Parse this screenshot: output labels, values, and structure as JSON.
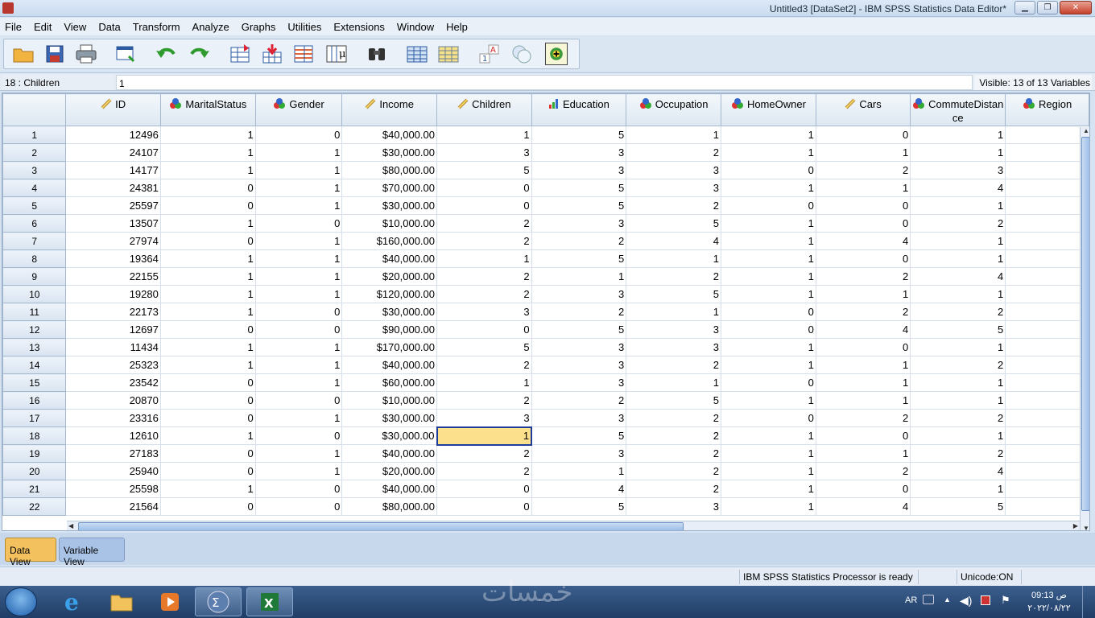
{
  "window": {
    "title": "Untitled3 [DataSet2] - IBM SPSS Statistics Data Editor*"
  },
  "menu": [
    "File",
    "Edit",
    "View",
    "Data",
    "Transform",
    "Analyze",
    "Graphs",
    "Utilities",
    "Extensions",
    "Window",
    "Help"
  ],
  "toolbar_icons": [
    "open-folder-icon",
    "save-icon",
    "print-icon",
    "dialog-recall-icon",
    "undo-icon",
    "redo-icon",
    "goto-case-icon",
    "goto-variable-icon",
    "variables-icon",
    "mu-icon",
    "find-icon",
    "insert-cases-icon",
    "insert-variable-icon",
    "split-file-icon",
    "weight-cases-icon",
    "select-cases-icon",
    "value-labels-icon"
  ],
  "cell_editor": {
    "reference": "18 : Children",
    "value": "1",
    "visible": "Visible: 13 of 13 Variables"
  },
  "columns": [
    {
      "name": "ID",
      "icon": "scale-ruler-icon"
    },
    {
      "name": "MaritalStatus",
      "icon": "nominal-icon"
    },
    {
      "name": "Gender",
      "icon": "nominal-icon"
    },
    {
      "name": "Income",
      "icon": "scale-ruler-icon"
    },
    {
      "name": "Children",
      "icon": "scale-ruler-icon"
    },
    {
      "name": "Education",
      "icon": "ordinal-icon"
    },
    {
      "name": "Occupation",
      "icon": "nominal-icon"
    },
    {
      "name": "HomeOwner",
      "icon": "nominal-icon"
    },
    {
      "name": "Cars",
      "icon": "scale-ruler-icon"
    },
    {
      "name": "CommuteDistan",
      "name2": "ce",
      "icon": "nominal-icon"
    },
    {
      "name": "Region",
      "icon": "nominal-icon"
    }
  ],
  "rows": [
    [
      "1",
      "12496",
      "1",
      "0",
      "$40,000.00",
      "1",
      "5",
      "1",
      "1",
      "0",
      "1",
      ""
    ],
    [
      "2",
      "24107",
      "1",
      "1",
      "$30,000.00",
      "3",
      "3",
      "2",
      "1",
      "1",
      "1",
      ""
    ],
    [
      "3",
      "14177",
      "1",
      "1",
      "$80,000.00",
      "5",
      "3",
      "3",
      "0",
      "2",
      "3",
      ""
    ],
    [
      "4",
      "24381",
      "0",
      "1",
      "$70,000.00",
      "0",
      "5",
      "3",
      "1",
      "1",
      "4",
      ""
    ],
    [
      "5",
      "25597",
      "0",
      "1",
      "$30,000.00",
      "0",
      "5",
      "2",
      "0",
      "0",
      "1",
      ""
    ],
    [
      "6",
      "13507",
      "1",
      "0",
      "$10,000.00",
      "2",
      "3",
      "5",
      "1",
      "0",
      "2",
      ""
    ],
    [
      "7",
      "27974",
      "0",
      "1",
      "$160,000.00",
      "2",
      "2",
      "4",
      "1",
      "4",
      "1",
      ""
    ],
    [
      "8",
      "19364",
      "1",
      "1",
      "$40,000.00",
      "1",
      "5",
      "1",
      "1",
      "0",
      "1",
      ""
    ],
    [
      "9",
      "22155",
      "1",
      "1",
      "$20,000.00",
      "2",
      "1",
      "2",
      "1",
      "2",
      "4",
      ""
    ],
    [
      "10",
      "19280",
      "1",
      "1",
      "$120,000.00",
      "2",
      "3",
      "5",
      "1",
      "1",
      "1",
      ""
    ],
    [
      "11",
      "22173",
      "1",
      "0",
      "$30,000.00",
      "3",
      "2",
      "1",
      "0",
      "2",
      "2",
      ""
    ],
    [
      "12",
      "12697",
      "0",
      "0",
      "$90,000.00",
      "0",
      "5",
      "3",
      "0",
      "4",
      "5",
      ""
    ],
    [
      "13",
      "11434",
      "1",
      "1",
      "$170,000.00",
      "5",
      "3",
      "3",
      "1",
      "0",
      "1",
      ""
    ],
    [
      "14",
      "25323",
      "1",
      "1",
      "$40,000.00",
      "2",
      "3",
      "2",
      "1",
      "1",
      "2",
      ""
    ],
    [
      "15",
      "23542",
      "0",
      "1",
      "$60,000.00",
      "1",
      "3",
      "1",
      "0",
      "1",
      "1",
      ""
    ],
    [
      "16",
      "20870",
      "0",
      "0",
      "$10,000.00",
      "2",
      "2",
      "5",
      "1",
      "1",
      "1",
      ""
    ],
    [
      "17",
      "23316",
      "0",
      "1",
      "$30,000.00",
      "3",
      "3",
      "2",
      "0",
      "2",
      "2",
      ""
    ],
    [
      "18",
      "12610",
      "1",
      "0",
      "$30,000.00",
      "1",
      "5",
      "2",
      "1",
      "0",
      "1",
      ""
    ],
    [
      "19",
      "27183",
      "0",
      "1",
      "$40,000.00",
      "2",
      "3",
      "2",
      "1",
      "1",
      "2",
      ""
    ],
    [
      "20",
      "25940",
      "0",
      "1",
      "$20,000.00",
      "2",
      "1",
      "2",
      "1",
      "2",
      "4",
      ""
    ],
    [
      "21",
      "25598",
      "1",
      "0",
      "$40,000.00",
      "0",
      "4",
      "2",
      "1",
      "0",
      "1",
      ""
    ],
    [
      "22",
      "21564",
      "0",
      "0",
      "$80,000.00",
      "0",
      "5",
      "3",
      "1",
      "4",
      "5",
      ""
    ]
  ],
  "selected_cell": {
    "row": "18",
    "column": "Children"
  },
  "tabs": {
    "data_view": "Data View",
    "variable_view": "Variable View"
  },
  "status": {
    "processor": "IBM SPSS Statistics Processor is ready",
    "encoding": "Unicode:ON"
  },
  "taskbar": {
    "lang": "AR",
    "time": "09:13 ص",
    "date": "٢٠٢٢/٠٨/٢٢",
    "watermark": "خمسات"
  }
}
